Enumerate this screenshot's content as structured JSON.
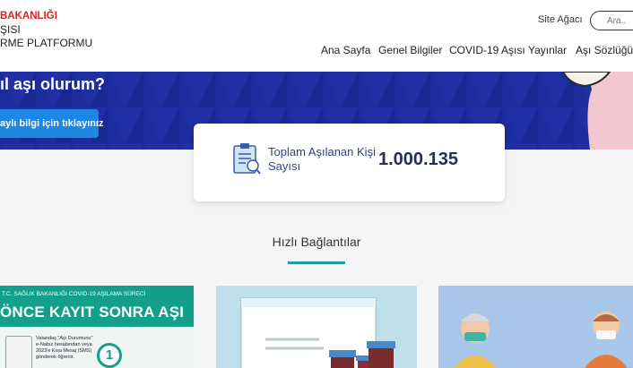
{
  "header": {
    "logo_lines": [
      "BAKANLIĞI",
      "ŞISI",
      "RME PLATFORMU"
    ],
    "site_map": "Site Ağacı",
    "search_placeholder": "Ara..",
    "nav": [
      "Ana Sayfa",
      "Genel Bilgiler",
      "COVID-19 Aşısı",
      "Yayınlar",
      "Aşı Sözlüğü"
    ]
  },
  "hero": {
    "title": "ıl aşı olurum?",
    "button": "aylı bilgi için tıklayınız"
  },
  "stat": {
    "label": "Toplam Aşılanan Kişi Sayısı",
    "value": "1.000.135",
    "icon": "clipboard-icon"
  },
  "quick_links": {
    "title": "Hızlı Bağlantılar",
    "card1": {
      "subtitle": "T.C. SAĞLIK BAKANLIĞI COVID-19 AŞILAMA SÜRECİ",
      "title": "ÖNCE KAYIT SONRA AŞI",
      "text": "Vatandaş \"Aşı Durumunu\" e-Nabız hesabından veya 2023'e Kısa Mesaj (SMS) gönderek öğrenir.",
      "step": "1"
    }
  },
  "colors": {
    "hero_blue": "#1b2c9c",
    "button_blue": "#1f86e4",
    "accent_teal": "#12a08a",
    "logo_red": "#d5251b"
  }
}
